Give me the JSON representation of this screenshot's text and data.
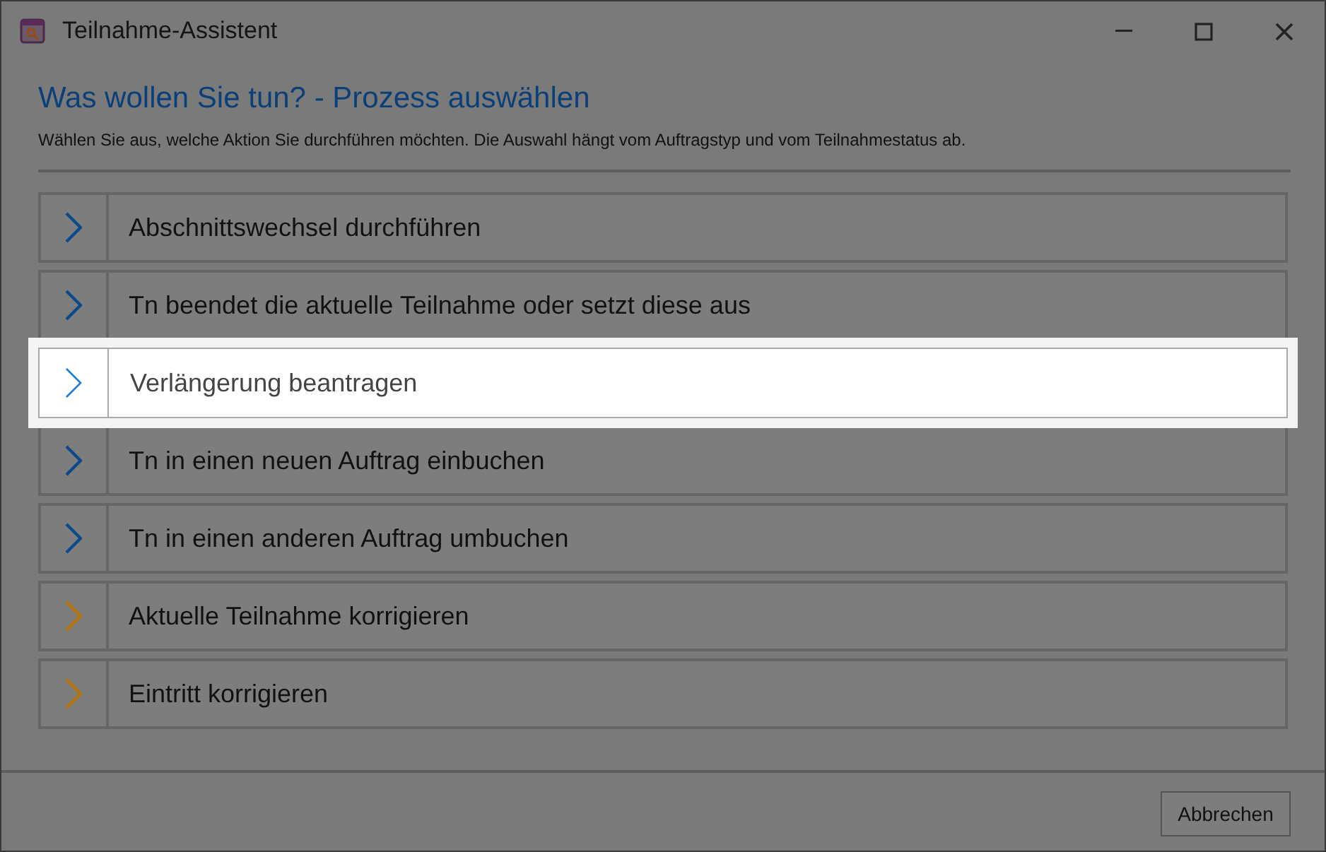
{
  "window": {
    "title": "Teilnahme-Assistent"
  },
  "heading": "Was wollen Sie tun? - Prozess auswählen",
  "description": "Wählen Sie aus, welche Aktion Sie durchführen möchten. Die Auswahl hängt vom Auftragstyp und vom Teilnahmestatus ab.",
  "options": [
    {
      "label": "Abschnittswechsel durchführen",
      "color": "#0d4a8a",
      "selected": false
    },
    {
      "label": "Tn beendet die aktuelle Teilnahme oder setzt diese aus",
      "color": "#0d4a8a",
      "selected": false
    },
    {
      "label": "Verlängerung beantragen",
      "color": "#1a7fd4",
      "selected": true
    },
    {
      "label": "Tn in einen neuen Auftrag einbuchen",
      "color": "#0d4a8a",
      "selected": false
    },
    {
      "label": "Tn in einen anderen Auftrag umbuchen",
      "color": "#0d4a8a",
      "selected": false
    },
    {
      "label": "Aktuelle Teilnahme korrigieren",
      "color": "#b5730f",
      "selected": false
    },
    {
      "label": "Eintritt korrigieren",
      "color": "#b5730f",
      "selected": false
    }
  ],
  "buttons": [
    "Abbrechen"
  ]
}
